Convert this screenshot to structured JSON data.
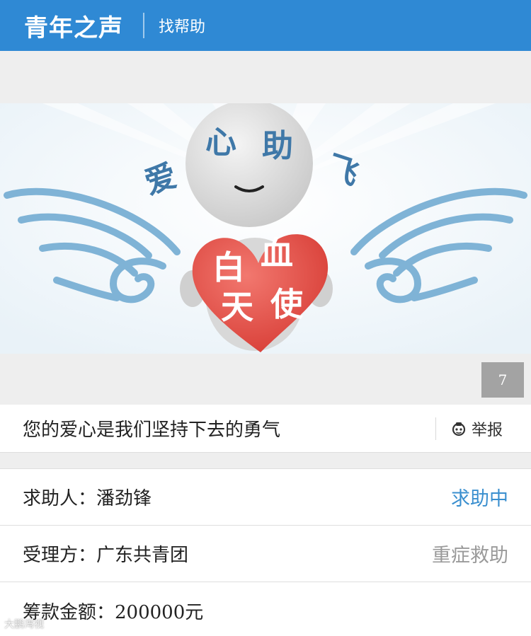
{
  "header": {
    "logo": "青年之声",
    "link": "找帮助"
  },
  "banner": {
    "top_text": [
      "爱",
      "心",
      "助",
      "飞"
    ],
    "heart_text": [
      "白",
      "血",
      "天",
      "使"
    ]
  },
  "counter": "7",
  "slogan": {
    "text": "您的爱心是我们坚持下去的勇气",
    "report": "举报"
  },
  "info": {
    "requester_label": "求助人：",
    "requester_name": "潘劲锋",
    "requester_status": "求助中",
    "handler_label": "受理方：",
    "handler_name": "广东共青团",
    "handler_category": "重症救助",
    "amount_label": "筹款金额：",
    "amount_value": "200000元"
  },
  "watermark": "大鹏湾视"
}
